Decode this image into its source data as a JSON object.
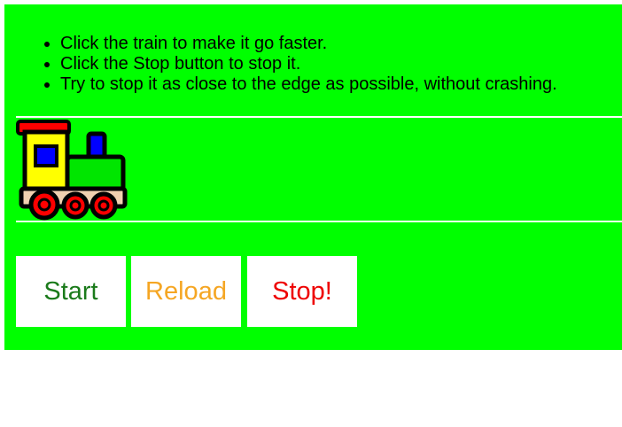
{
  "instructions": {
    "items": [
      "Click the train to make it go faster.",
      "Click the Stop button to stop it.",
      "Try to stop it as close to the edge as possible, without crashing."
    ]
  },
  "train": {
    "icon": "train-icon"
  },
  "controls": {
    "start_label": "Start",
    "reload_label": "Reload",
    "stop_label": "Stop!"
  },
  "colors": {
    "background": "#00ff00",
    "start": "#1a7a1a",
    "reload": "#f5a623",
    "stop": "#ee0000"
  }
}
